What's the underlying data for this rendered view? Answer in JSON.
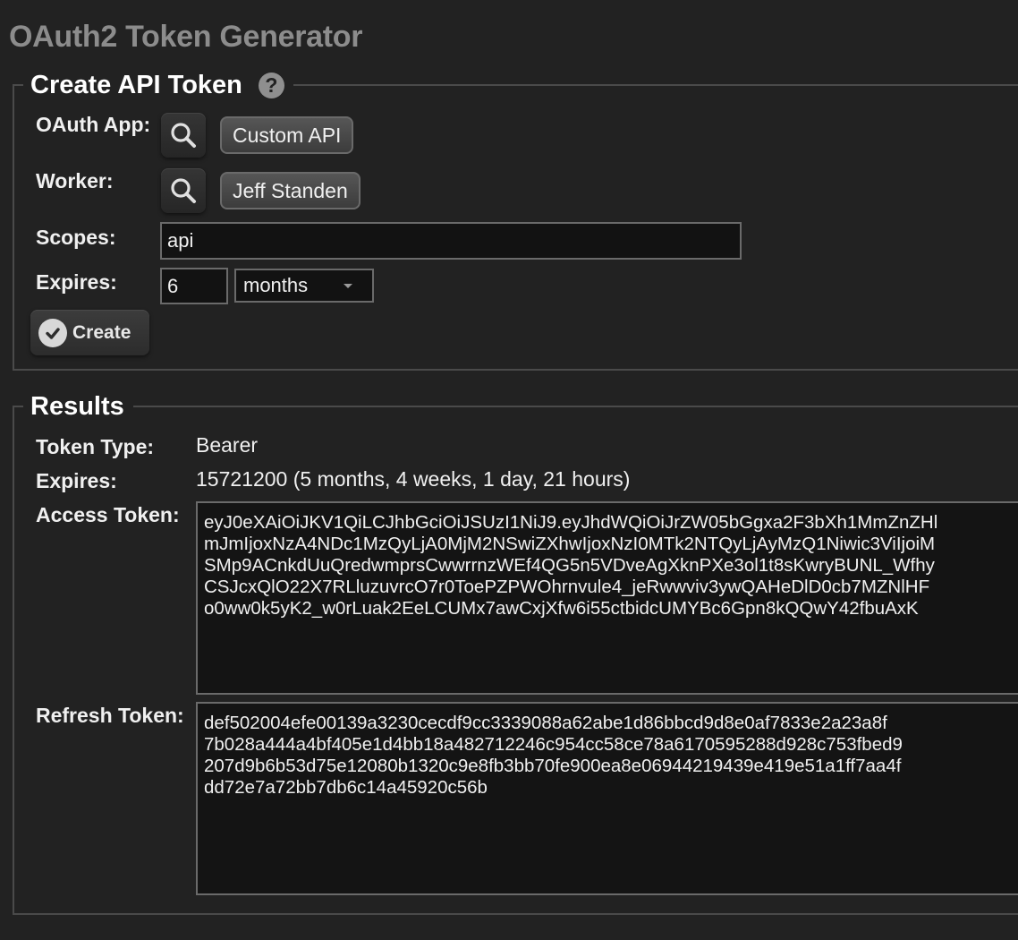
{
  "page": {
    "title": "OAuth2 Token Generator"
  },
  "create_section": {
    "legend": "Create API Token",
    "help_icon": "question-mark-icon",
    "oauth_app": {
      "label": "OAuth App:",
      "lookup_icon": "search-icon",
      "value": "Custom API"
    },
    "worker": {
      "label": "Worker:",
      "lookup_icon": "search-icon",
      "value": "Jeff Standen"
    },
    "scopes": {
      "label": "Scopes:",
      "value": "api"
    },
    "expires": {
      "label": "Expires:",
      "amount": "6",
      "unit_selected": "months"
    },
    "create_button": {
      "label": "Create",
      "icon": "checkmark-icon"
    }
  },
  "results_section": {
    "legend": "Results",
    "token_type": {
      "label": "Token Type:",
      "value": "Bearer"
    },
    "expires": {
      "label": "Expires:",
      "value": "15721200 (5 months, 4 weeks, 1 day, 21 hours)"
    },
    "access_token": {
      "label": "Access Token:",
      "value": "eyJ0eXAiOiJKV1QiLCJhbGciOiJSUzI1NiJ9.eyJhdWQiOiJrZW05bGgxa2F3bXh1MmZnZHl\nmJmIjoxNzA4NDc1MzQyLjA0MjM2NSwiZXhwIjoxNzI0MTk2NTQyLjAyMzQ1Niwic3ViIjoiM\nSMp9ACnkdUuQredwmprsCwwrrnzWEf4QG5n5VDveAgXknPXe3ol1t8sKwryBUNL_Wfhy\nCSJcxQlO22X7RLluzuvrcO7r0ToePZPWOhrnvule4_jeRwwviv3ywQAHeDlD0cb7MZNlHF\no0ww0k5yK2_w0rLuak2EeLCUMx7awCxjXfw6i55ctbidcUMYBc6Gpn8kQQwY42fbuAxK"
    },
    "refresh_token": {
      "label": "Refresh Token:",
      "value": "def502004efe00139a3230cecdf9cc3339088a62abe1d86bbcd9d8e0af7833e2a23a8f\n7b028a444a4bf405e1d4bb18a482712246c954cc58ce78a6170595288d928c753fbed9\n207d9b6b53d75e12080b1320c9e8fb3bb70fe900ea8e06944219439e419e51a1ff7aa4f\ndd72e7a72bb7db6c14a45920c56b"
    }
  }
}
